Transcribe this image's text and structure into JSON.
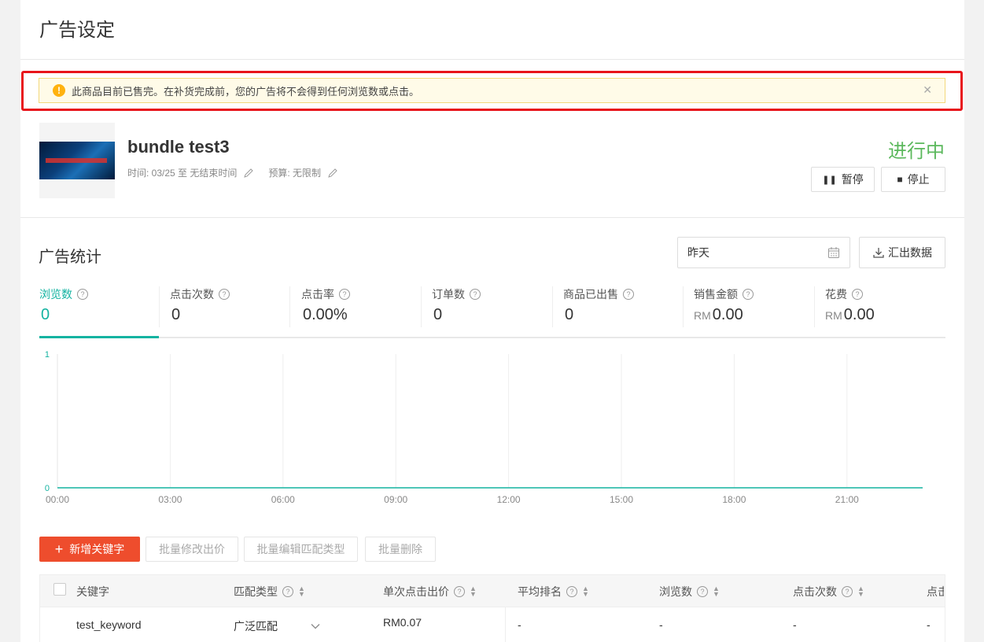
{
  "page": {
    "title": "广告设定"
  },
  "alert": {
    "text": "此商品目前已售完。在补货完成前，您的广告将不会得到任何浏览数或点击。",
    "icon": "warning-icon"
  },
  "product": {
    "name": "bundle test3",
    "time_label": "时间: 03/25 至 无结束时间",
    "budget_label": "预算: 无限制",
    "status": "进行中"
  },
  "actions": {
    "pause": "暂停",
    "stop": "停止"
  },
  "stats": {
    "title": "广告统计",
    "date_range": "昨天",
    "export": "汇出数据",
    "metrics": [
      {
        "label": "浏览数",
        "value": "0",
        "unit": ""
      },
      {
        "label": "点击次数",
        "value": "0",
        "unit": ""
      },
      {
        "label": "点击率",
        "value": "0.00%",
        "unit": ""
      },
      {
        "label": "订单数",
        "value": "0",
        "unit": ""
      },
      {
        "label": "商品已出售",
        "value": "0",
        "unit": ""
      },
      {
        "label": "销售金额",
        "value": "0.00",
        "unit": "RM"
      },
      {
        "label": "花费",
        "value": "0.00",
        "unit": "RM"
      }
    ]
  },
  "chart_data": {
    "type": "line",
    "title": "",
    "xlabel": "",
    "ylabel": "",
    "x": [
      "00:00",
      "03:00",
      "06:00",
      "09:00",
      "12:00",
      "15:00",
      "18:00",
      "21:00"
    ],
    "series": [
      {
        "values": [
          0,
          0,
          0,
          0,
          0,
          0,
          0,
          0
        ]
      }
    ],
    "ylim": [
      0,
      1
    ],
    "yticks": [
      "0",
      "1"
    ],
    "grid": true,
    "color": "#14b3a1"
  },
  "keywords": {
    "toolbar": {
      "add": "新增关键字",
      "bulk_edit_price": "批量修改出价",
      "bulk_edit_match": "批量编辑匹配类型",
      "bulk_delete": "批量删除"
    },
    "columns": [
      "关键字",
      "匹配类型",
      "单次点击出价",
      "平均排名",
      "浏览数",
      "点击次数",
      "点击"
    ],
    "rows": [
      {
        "keyword": "test_keyword",
        "match": "广泛匹配",
        "bid": "RM0.07",
        "rank": "-",
        "views": "-",
        "clicks": "-",
        "more": "-"
      }
    ]
  }
}
